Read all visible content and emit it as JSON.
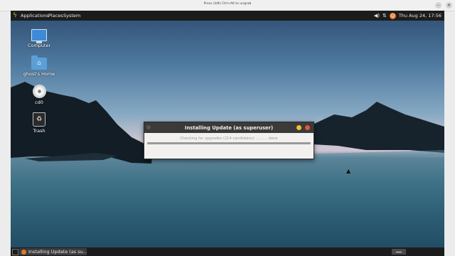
{
  "vm_window": {
    "title": "Press (left) Ctrl+Alt to ungrab",
    "buttons": [
      "–",
      "×"
    ]
  },
  "top_panel": {
    "menus": [
      "Applications",
      "Places",
      "System"
    ],
    "clock": "Thu Aug 24, 17:56",
    "tray_icons": [
      "volume-icon",
      "network-icon",
      "user-icon"
    ],
    "accent_color": "#8fd14f"
  },
  "desktop": {
    "icons": [
      {
        "label": "Computer",
        "icon": "computer-icon"
      },
      {
        "label": "ghost's Home",
        "icon": "home-folder-icon"
      },
      {
        "label": "cd0",
        "icon": "disc-icon"
      },
      {
        "label": "Trash",
        "icon": "trash-icon"
      }
    ]
  },
  "dialog": {
    "title": "Installing Update (as superuser)",
    "status": "Checking for upgrades (214 candidates) .......... done",
    "progress": 1.0,
    "colors": {
      "minimize": "#f0c02c",
      "close": "#e0593a"
    }
  },
  "bottom_panel": {
    "task_label": "Installing Update (as su..."
  }
}
